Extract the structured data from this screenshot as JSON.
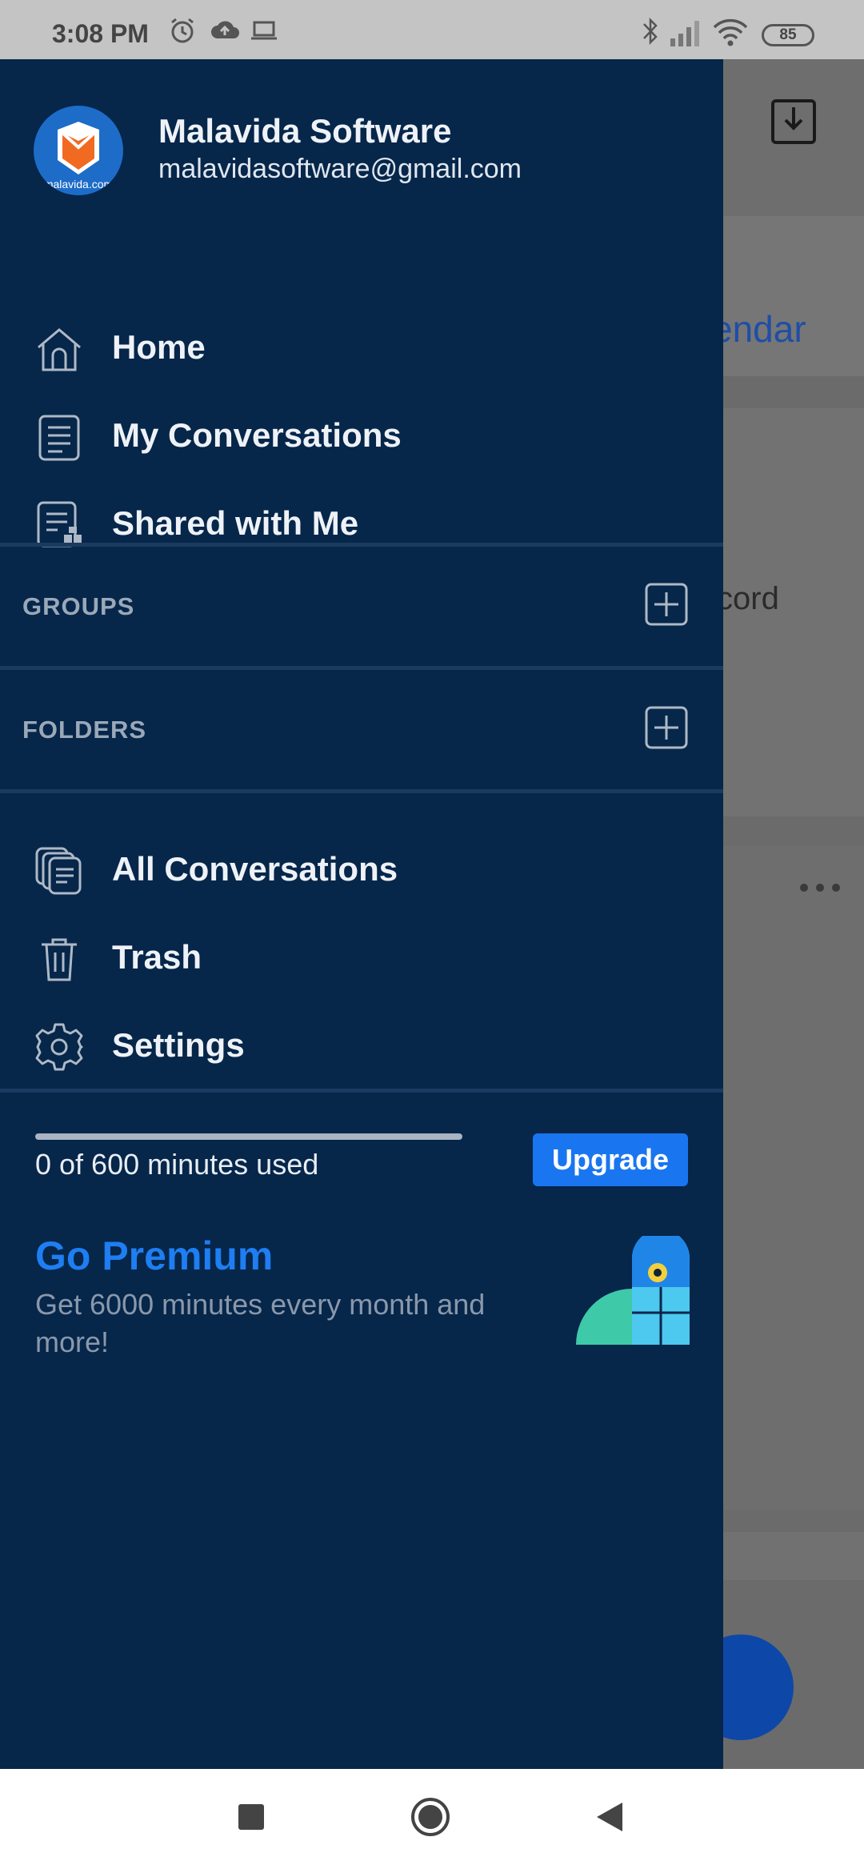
{
  "status_bar": {
    "time": "3:08 PM",
    "icons": [
      "alarm-icon",
      "cloud-upload-icon",
      "laptop-icon",
      "bluetooth-icon",
      "signal-icon",
      "wifi-icon"
    ],
    "battery": "85"
  },
  "background": {
    "calendar_text": "endar",
    "record_text": "cord"
  },
  "drawer": {
    "profile": {
      "name": "Malavida Software",
      "email": "malavidasoftware@gmail.com",
      "avatar_lettering": "malavida.com"
    },
    "primary_items": [
      {
        "label": "Home",
        "icon": "home-icon"
      },
      {
        "label": "My Conversations",
        "icon": "document-icon"
      },
      {
        "label": "Shared with Me",
        "icon": "shared-document-icon"
      }
    ],
    "groups_title": "GROUPS",
    "folders_title": "FOLDERS",
    "secondary_items": [
      {
        "label": "All Conversations",
        "icon": "stacked-documents-icon"
      },
      {
        "label": "Trash",
        "icon": "trash-icon"
      },
      {
        "label": "Settings",
        "icon": "gear-icon"
      }
    ],
    "usage": {
      "text": "0 of 600 minutes used",
      "used_fraction": 0.0
    },
    "upgrade_label": "Upgrade",
    "premium": {
      "title": "Go Premium",
      "description": "Get 6000 minutes every month and more!"
    }
  },
  "colors": {
    "drawer_bg": "#06264a",
    "accent_blue": "#1976f0",
    "premium_blue": "#1e7ef2"
  },
  "nav_bar": {
    "buttons": [
      "recents-button",
      "home-button",
      "back-button"
    ]
  }
}
